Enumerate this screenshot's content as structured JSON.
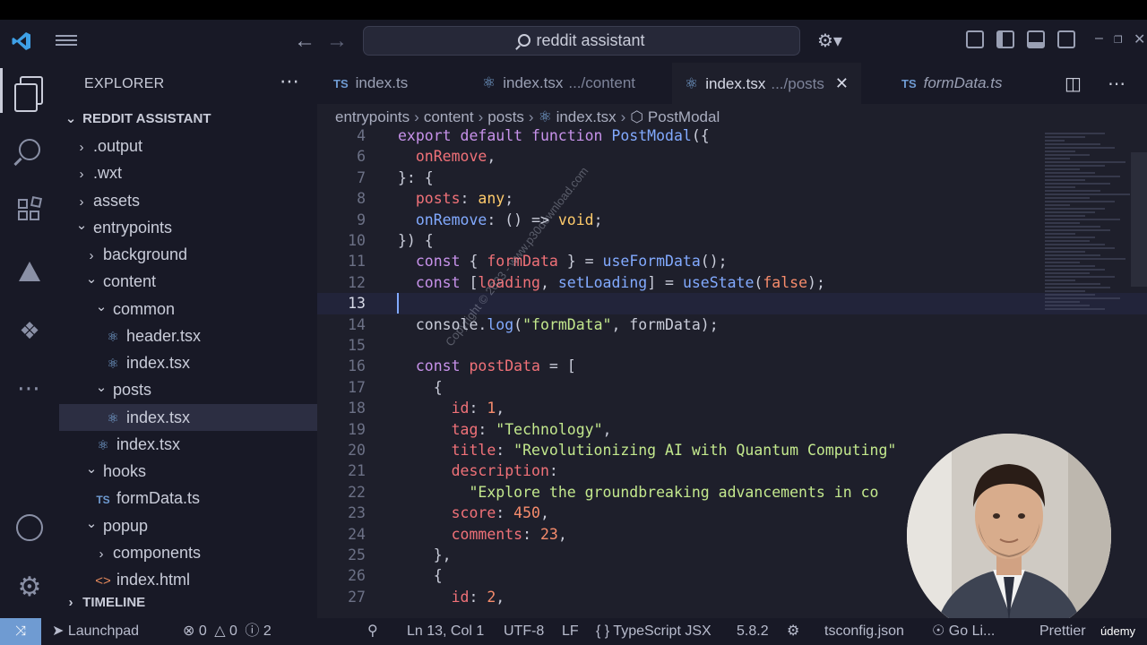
{
  "titlebar": {
    "search_text": "reddit assistant",
    "back_icon": "arrow-left",
    "forward_icon": "arrow-right"
  },
  "sidebar": {
    "title": "EXPLORER",
    "more": "⋯",
    "project": "REDDIT ASSISTANT",
    "timeline": "TIMELINE",
    "tree": [
      {
        "label": ".output",
        "kind": "folder",
        "open": false,
        "depth": 1
      },
      {
        "label": ".wxt",
        "kind": "folder",
        "open": false,
        "depth": 1
      },
      {
        "label": "assets",
        "kind": "folder",
        "open": false,
        "depth": 1
      },
      {
        "label": "entrypoints",
        "kind": "folder",
        "open": true,
        "depth": 1
      },
      {
        "label": "background",
        "kind": "folder",
        "open": false,
        "depth": 2
      },
      {
        "label": "content",
        "kind": "folder",
        "open": true,
        "depth": 2
      },
      {
        "label": "common",
        "kind": "folder",
        "open": true,
        "depth": 3
      },
      {
        "label": "header.tsx",
        "kind": "react",
        "depth": 4
      },
      {
        "label": "index.tsx",
        "kind": "react",
        "depth": 4
      },
      {
        "label": "posts",
        "kind": "folder",
        "open": true,
        "depth": 3
      },
      {
        "label": "index.tsx",
        "kind": "react",
        "depth": 4,
        "selected": true
      },
      {
        "label": "index.tsx",
        "kind": "react",
        "depth": 3
      },
      {
        "label": "hooks",
        "kind": "folder",
        "open": true,
        "depth": 2
      },
      {
        "label": "formData.ts",
        "kind": "ts",
        "depth": 3
      },
      {
        "label": "popup",
        "kind": "folder",
        "open": true,
        "depth": 2
      },
      {
        "label": "components",
        "kind": "folder",
        "open": false,
        "depth": 3
      },
      {
        "label": "index.html",
        "kind": "html",
        "depth": 3
      }
    ]
  },
  "tabs": [
    {
      "badge": "TS",
      "name": "index.ts",
      "desc": "",
      "active": false,
      "italic": false
    },
    {
      "badge": "react",
      "name": "index.tsx",
      "desc": ".../content",
      "active": false,
      "italic": false
    },
    {
      "badge": "react",
      "name": "index.tsx",
      "desc": ".../posts",
      "active": true,
      "italic": false
    },
    {
      "badge": "TS",
      "name": "formData.ts",
      "desc": "",
      "active": false,
      "italic": true
    }
  ],
  "breadcrumb": [
    "entrypoints",
    "content",
    "posts",
    "index.tsx",
    "PostModal"
  ],
  "code": [
    {
      "n": "4",
      "tokens": [
        [
          "kw",
          "export default function "
        ],
        [
          "fn",
          "PostModal"
        ],
        [
          "pl",
          "({"
        ]
      ]
    },
    {
      "n": "6",
      "tokens": [
        [
          "pl",
          "  "
        ],
        [
          "prop",
          "onRemove"
        ],
        [
          "pl",
          ","
        ]
      ]
    },
    {
      "n": "7",
      "tokens": [
        [
          "pl",
          "}: {"
        ]
      ]
    },
    {
      "n": "8",
      "tokens": [
        [
          "pl",
          "  "
        ],
        [
          "prop",
          "posts"
        ],
        [
          "pl",
          ": "
        ],
        [
          "ty",
          "any"
        ],
        [
          "pl",
          ";"
        ]
      ]
    },
    {
      "n": "9",
      "tokens": [
        [
          "pl",
          "  "
        ],
        [
          "fn",
          "onRemove"
        ],
        [
          "pl",
          ": () => "
        ],
        [
          "ty",
          "void"
        ],
        [
          "pl",
          ";"
        ]
      ]
    },
    {
      "n": "10",
      "tokens": [
        [
          "pl",
          "}) {"
        ]
      ]
    },
    {
      "n": "11",
      "tokens": [
        [
          "pl",
          "  "
        ],
        [
          "kw",
          "const "
        ],
        [
          "pl",
          "{ "
        ],
        [
          "prop",
          "formData"
        ],
        [
          "pl",
          " } = "
        ],
        [
          "fn",
          "useFormData"
        ],
        [
          "pl",
          "();"
        ]
      ]
    },
    {
      "n": "12",
      "tokens": [
        [
          "pl",
          "  "
        ],
        [
          "kw",
          "const "
        ],
        [
          "pl",
          "["
        ],
        [
          "prop",
          "loading"
        ],
        [
          "pl",
          ", "
        ],
        [
          "fn",
          "setLoading"
        ],
        [
          "pl",
          "] = "
        ],
        [
          "fn",
          "useState"
        ],
        [
          "pl",
          "("
        ],
        [
          "num",
          "false"
        ],
        [
          "pl",
          ");"
        ]
      ]
    },
    {
      "n": "13",
      "tokens": [],
      "current": true
    },
    {
      "n": "14",
      "tokens": [
        [
          "pl",
          "  console."
        ],
        [
          "fn",
          "log"
        ],
        [
          "pl",
          "("
        ],
        [
          "str",
          "\"formData\""
        ],
        [
          "pl",
          ", formData);"
        ]
      ]
    },
    {
      "n": "15",
      "tokens": []
    },
    {
      "n": "16",
      "tokens": [
        [
          "pl",
          "  "
        ],
        [
          "kw",
          "const "
        ],
        [
          "prop",
          "postData"
        ],
        [
          "pl",
          " = ["
        ]
      ]
    },
    {
      "n": "17",
      "tokens": [
        [
          "pl",
          "    {"
        ]
      ]
    },
    {
      "n": "18",
      "tokens": [
        [
          "pl",
          "      "
        ],
        [
          "prop",
          "id"
        ],
        [
          "pl",
          ": "
        ],
        [
          "num",
          "1"
        ],
        [
          "pl",
          ","
        ]
      ]
    },
    {
      "n": "19",
      "tokens": [
        [
          "pl",
          "      "
        ],
        [
          "prop",
          "tag"
        ],
        [
          "pl",
          ": "
        ],
        [
          "str",
          "\"Technology\""
        ],
        [
          "pl",
          ","
        ]
      ]
    },
    {
      "n": "20",
      "tokens": [
        [
          "pl",
          "      "
        ],
        [
          "prop",
          "title"
        ],
        [
          "pl",
          ": "
        ],
        [
          "str",
          "\"Revolutionizing AI with Quantum Computing\""
        ]
      ]
    },
    {
      "n": "21",
      "tokens": [
        [
          "pl",
          "      "
        ],
        [
          "prop",
          "description"
        ],
        [
          "pl",
          ":"
        ]
      ]
    },
    {
      "n": "22",
      "tokens": [
        [
          "pl",
          "        "
        ],
        [
          "str",
          "\"Explore the groundbreaking advancements in co"
        ]
      ]
    },
    {
      "n": "23",
      "tokens": [
        [
          "pl",
          "      "
        ],
        [
          "prop",
          "score"
        ],
        [
          "pl",
          ": "
        ],
        [
          "num",
          "450"
        ],
        [
          "pl",
          ","
        ]
      ]
    },
    {
      "n": "24",
      "tokens": [
        [
          "pl",
          "      "
        ],
        [
          "prop",
          "comments"
        ],
        [
          "pl",
          ": "
        ],
        [
          "num",
          "23"
        ],
        [
          "pl",
          ","
        ]
      ]
    },
    {
      "n": "25",
      "tokens": [
        [
          "pl",
          "    },"
        ]
      ]
    },
    {
      "n": "26",
      "tokens": [
        [
          "pl",
          "    {"
        ]
      ]
    },
    {
      "n": "27",
      "tokens": [
        [
          "pl",
          "      "
        ],
        [
          "prop",
          "id"
        ],
        [
          "pl",
          ": "
        ],
        [
          "num",
          "2"
        ],
        [
          "pl",
          ","
        ]
      ]
    }
  ],
  "watermark": "Copyright © 2023 - www.p30download.com",
  "status": {
    "launchpad": "Launchpad",
    "errors": "0",
    "warnings": "0",
    "info": "2",
    "position": "Ln 13, Col 1",
    "encoding": "UTF-8",
    "eol": "LF",
    "language": "TypeScript JSX",
    "ts_version": "5.8.2",
    "tsconfig": "tsconfig.json",
    "golive": "Go Li...",
    "prettier": "Prettier",
    "udemy": "údemy"
  },
  "colors": {
    "accent": "#6f9bd2",
    "background": "#1e1f2b",
    "sidebar": "#181926"
  }
}
